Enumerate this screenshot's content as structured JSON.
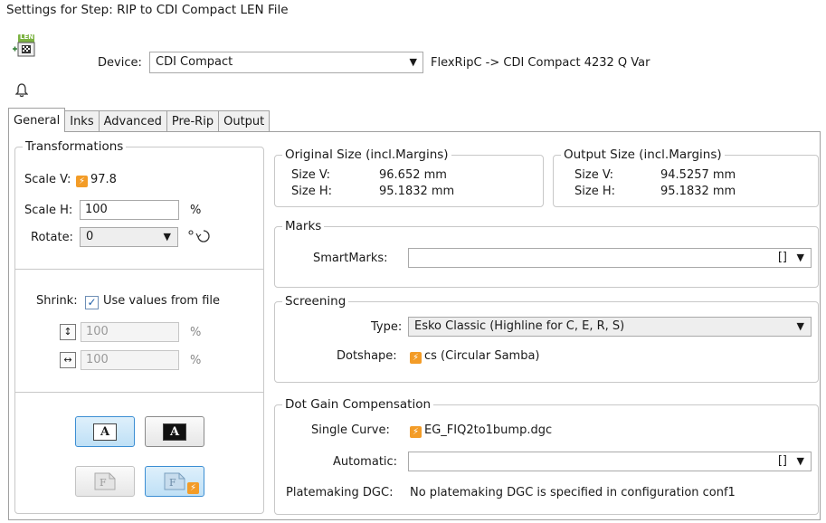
{
  "window": {
    "title": "Settings for Step: RIP to CDI Compact LEN File"
  },
  "step_icon": {
    "badge": "LEN",
    "name": "len-file-icon"
  },
  "device": {
    "label": "Device:",
    "selected": "CDI Compact",
    "description": "FlexRipC -> CDI Compact 4232 Q Var"
  },
  "tabs": [
    "General",
    "Inks",
    "Advanced",
    "Pre-Rip",
    "Output"
  ],
  "active_tab": "General",
  "transformations": {
    "title": "Transformations",
    "scale_v_label": "Scale V:",
    "scale_v_value": "97.8",
    "scale_h_label": "Scale H:",
    "scale_h_value": "100",
    "percent": "%",
    "rotate_label": "Rotate:",
    "rotate_value": "0"
  },
  "shrink": {
    "label": "Shrink:",
    "checkbox_label": "Use values from file",
    "checked": true,
    "vertical_value": "100",
    "horizontal_value": "100",
    "percent": "%"
  },
  "original_size": {
    "title": "Original Size (incl.Margins)",
    "size_v_label": "Size V:",
    "size_v_value": "96.652 mm",
    "size_h_label": "Size H:",
    "size_h_value": "95.1832 mm"
  },
  "output_size": {
    "title": "Output Size (incl.Margins)",
    "size_v_label": "Size V:",
    "size_v_value": "94.5257 mm",
    "size_h_label": "Size H:",
    "size_h_value": "95.1832 mm"
  },
  "marks": {
    "title": "Marks",
    "smartmarks_label": "SmartMarks:",
    "smartmarks_value": "[]"
  },
  "screening": {
    "title": "Screening",
    "type_label": "Type:",
    "type_value": "Esko Classic (Highline for C, E, R, S)",
    "dotshape_label": "Dotshape:",
    "dotshape_value": "cs (Circular Samba)"
  },
  "dgc": {
    "title": "Dot Gain Compensation",
    "single_curve_label": "Single Curve:",
    "single_curve_value": "EG_FIQ2to1bump.dgc",
    "automatic_label": "Automatic:",
    "automatic_value": "[]",
    "platemaking_label": "Platemaking DGC:",
    "platemaking_value": "No platemaking DGC is specified in configuration conf1"
  },
  "glyphs": {
    "positive": "A",
    "negative": "A",
    "flip_left": "F",
    "flip_right": "F"
  },
  "colors": {
    "accent": "#3c8ed3",
    "override_bolt": "#f39c27"
  }
}
